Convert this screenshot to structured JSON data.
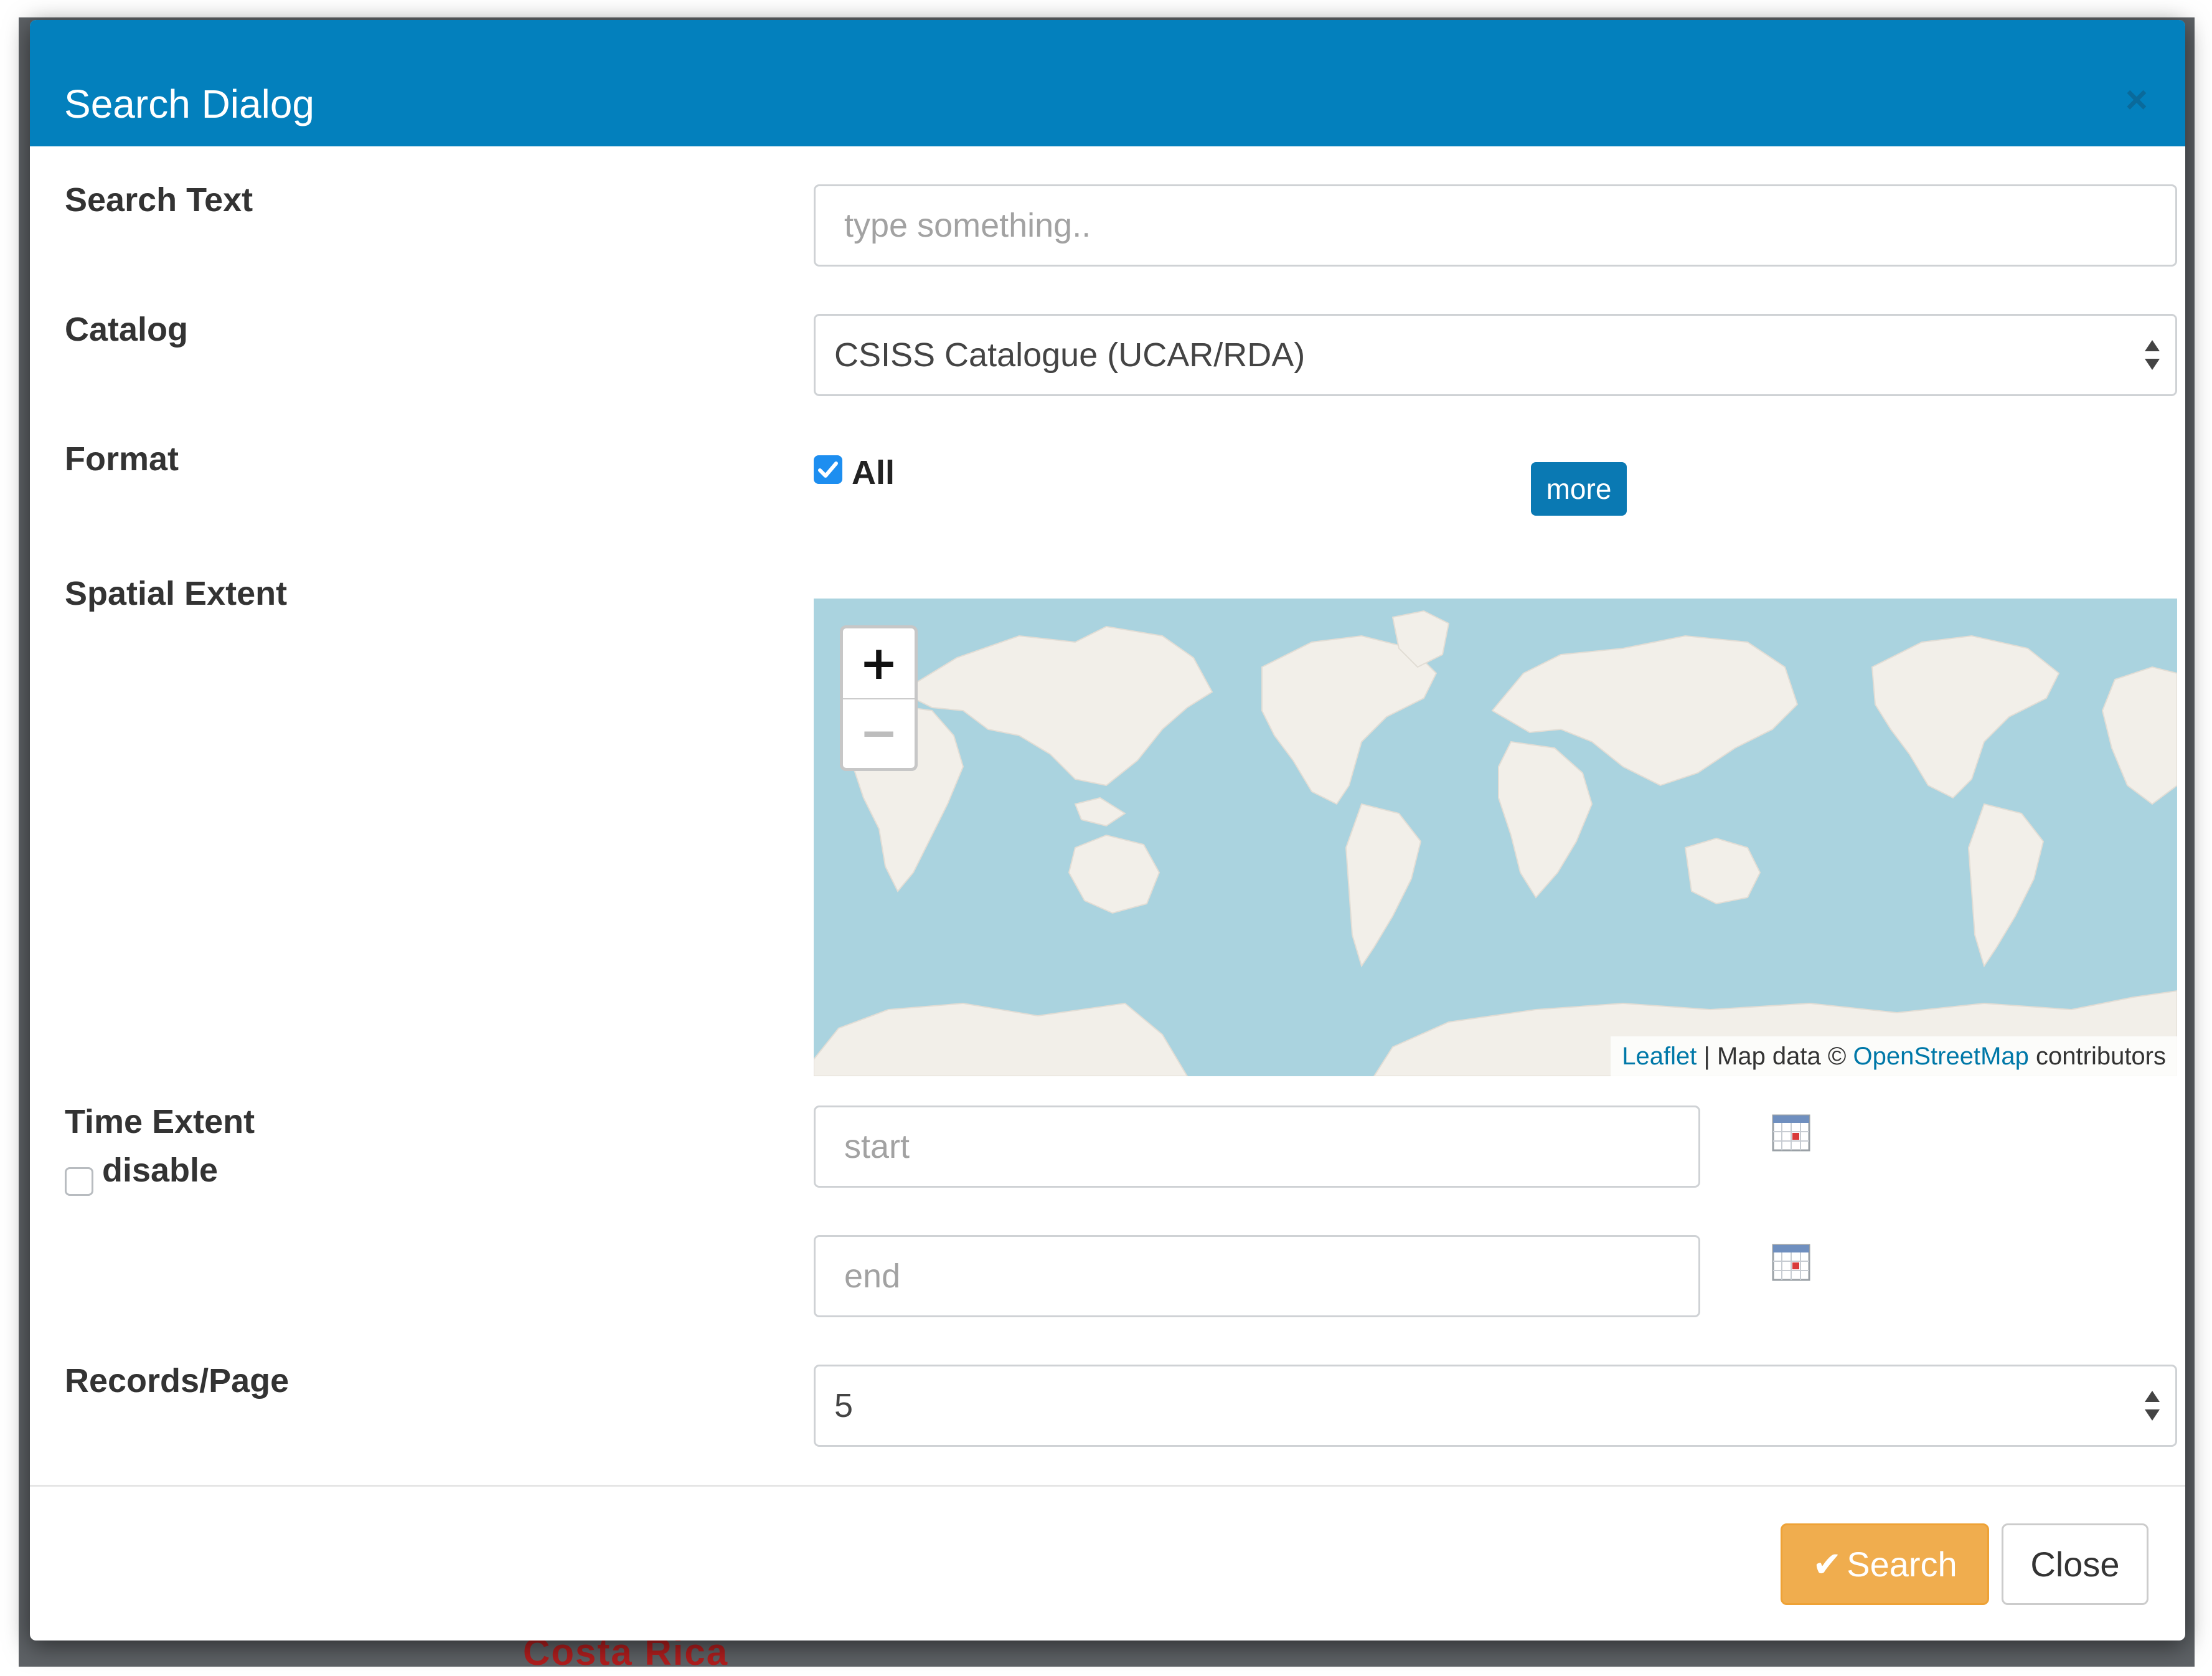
{
  "backdrop": {
    "label": "Costa Rica"
  },
  "dialog": {
    "title": "Search Dialog",
    "close_glyph": "×"
  },
  "search_text": {
    "label": "Search Text",
    "placeholder": "type something..",
    "value": ""
  },
  "catalog": {
    "label": "Catalog",
    "selected": "CSISS Catalogue (UCAR/RDA)"
  },
  "format": {
    "label": "Format",
    "all_label": "All",
    "all_checked": true,
    "more_label": "more"
  },
  "spatial_extent": {
    "label": "Spatial Extent",
    "map": {
      "zoom_in": "+",
      "zoom_out": "−",
      "attribution_leaflet": "Leaflet",
      "attribution_separator": "|",
      "attribution_text": "Map data ©",
      "attribution_osm": "OpenStreetMap",
      "attribution_suffix": "contributors",
      "ocean_color": "#aad3df",
      "land_color": "#f2efe9"
    }
  },
  "time_extent": {
    "label": "Time Extent",
    "disable_label": "disable",
    "disable_checked": false,
    "start_placeholder": "start",
    "end_placeholder": "end",
    "calendar_icon": "calendar-icon"
  },
  "records_per_page": {
    "label": "Records/Page",
    "selected": "5"
  },
  "footer": {
    "search_label": "Search",
    "close_label": "Close"
  },
  "colors": {
    "header": "#0380bd",
    "more_button": "#0a79b3",
    "search_button": "#f0ad4e",
    "checkbox": "#1d8ef0"
  }
}
